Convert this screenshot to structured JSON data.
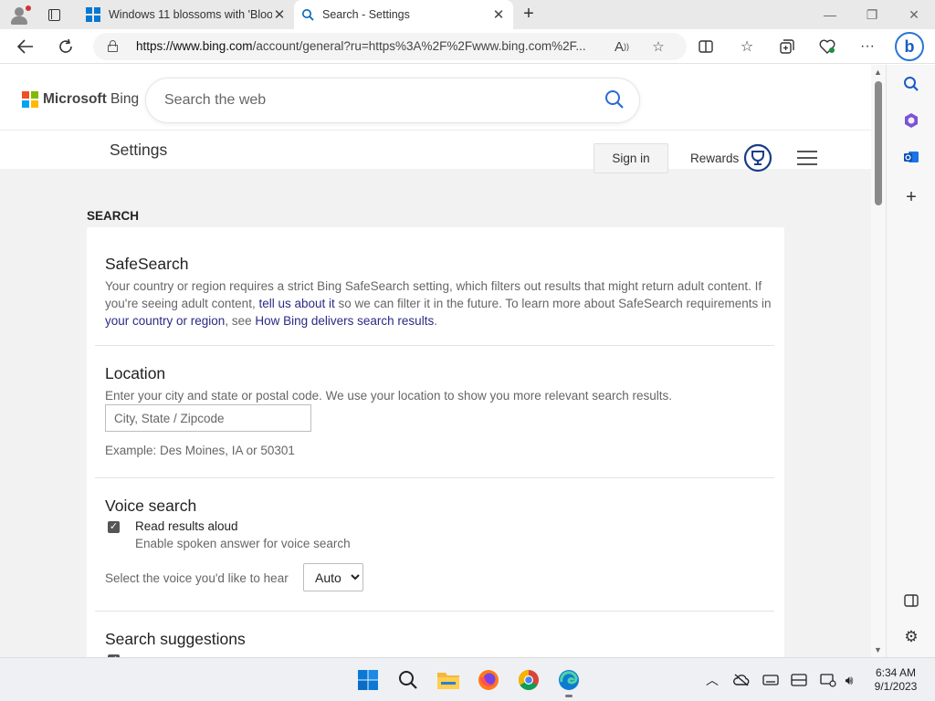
{
  "browser": {
    "tabs": [
      {
        "title": "Windows 11 blossoms with 'Bloo",
        "icon": "windows-logo-icon"
      },
      {
        "title": "Search - Settings",
        "icon": "search-icon"
      }
    ],
    "url_host": "https://www.bing.com",
    "url_rest": "/account/general?ru=https%3A%2F%2Fwww.bing.com%2F..."
  },
  "header": {
    "brand_bold": "Microsoft",
    "brand_rest": " Bing",
    "search_placeholder": "Search the web"
  },
  "subheader": {
    "title": "Settings",
    "signin_label": "Sign in",
    "rewards_label": "Rewards"
  },
  "settings": {
    "section_label": "SEARCH",
    "safesearch": {
      "title": "SafeSearch",
      "text1": "Your country or region requires a strict Bing SafeSearch setting, which filters out results that might return adult content. If you're seeing adult content, ",
      "link1": "tell us about it",
      "text2": " so we can filter it in the future. To learn more about SafeSearch requirements in ",
      "link2": "your country or region",
      "text3": ", see ",
      "link3": "How Bing delivers search results",
      "text4": "."
    },
    "location": {
      "title": "Location",
      "description": "Enter your city and state or postal code. We use your location to show you more relevant search results.",
      "placeholder": "City, State / Zipcode",
      "example": "Example: Des Moines, IA or 50301"
    },
    "voice": {
      "title": "Voice search",
      "checkbox_label": "Read results aloud",
      "checkbox_sub": "Enable spoken answer for voice search",
      "checked": true,
      "select_label": "Select the voice you'd like to hear",
      "select_value": "Auto"
    },
    "suggestions": {
      "title": "Search suggestions"
    }
  },
  "taskbar": {
    "time": "6:34 AM",
    "date": "9/1/2023"
  },
  "colors": {
    "accent": "#0078d4",
    "link": "#2a2a86",
    "ms_red": "#f25022",
    "ms_green": "#7fba00",
    "ms_blue": "#00a4ef",
    "ms_yellow": "#ffb900"
  }
}
